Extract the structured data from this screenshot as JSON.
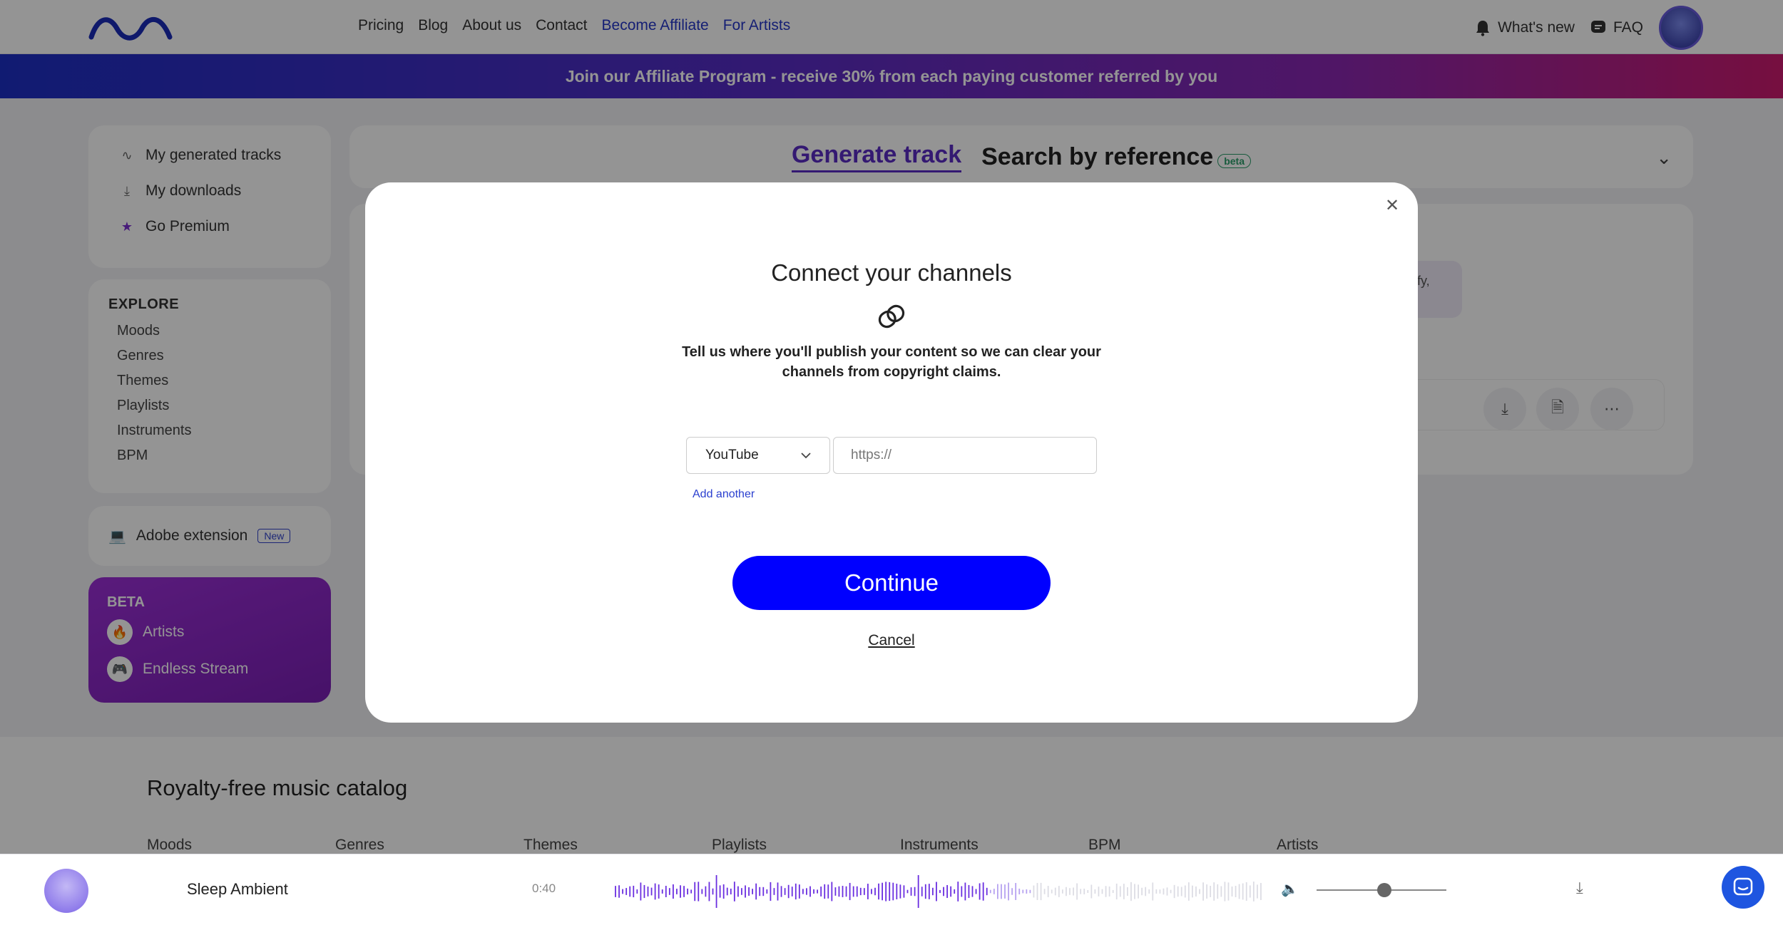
{
  "nav": {
    "links": [
      "Pricing",
      "Blog",
      "About us",
      "Contact",
      "Become Affiliate",
      "For Artists"
    ],
    "whats_new": "What's new",
    "faq": "FAQ"
  },
  "banner": {
    "text": "Join our Affiliate Program - receive 30% from each paying customer referred by you"
  },
  "sidebar": {
    "links": [
      {
        "label": "My generated tracks",
        "icon": "wave-icon"
      },
      {
        "label": "My downloads",
        "icon": "download-icon"
      },
      {
        "label": "Go Premium",
        "icon": "star-icon"
      }
    ],
    "explore": {
      "heading": "EXPLORE",
      "items": [
        "Moods",
        "Genres",
        "Themes",
        "Playlists",
        "Instruments",
        "BPM"
      ]
    },
    "adobe": {
      "label": "Adobe extension",
      "badge": "New"
    },
    "beta": {
      "heading": "BETA",
      "items": [
        {
          "label": "Artists",
          "icon": "fire-icon"
        },
        {
          "label": "Endless Stream",
          "icon": "gamepad-icon"
        }
      ]
    }
  },
  "generator": {
    "tab_generate": "Generate track",
    "tab_search": "Search by reference",
    "beta_badge": "beta",
    "partial_text": "tify,"
  },
  "catalog": {
    "title": "Royalty-free music catalog",
    "tabs": [
      "Moods",
      "Genres",
      "Themes",
      "Playlists",
      "Instruments",
      "BPM",
      "Artists"
    ]
  },
  "player": {
    "track_title": "Sleep Ambient",
    "time": "0:40",
    "volume": 0.52
  },
  "modal": {
    "title": "Connect your channels",
    "description": "Tell us where you'll publish your content so we can clear your channels from copyright claims.",
    "platform_selected": "YouTube",
    "url_placeholder": "https://",
    "url_value": "",
    "add_another": "Add another",
    "continue_label": "Continue",
    "cancel_label": "Cancel"
  },
  "colors": {
    "accent_blue": "#0000ff",
    "brand_purple": "#5b2bc4",
    "beta_purple": "#8a27c4"
  }
}
